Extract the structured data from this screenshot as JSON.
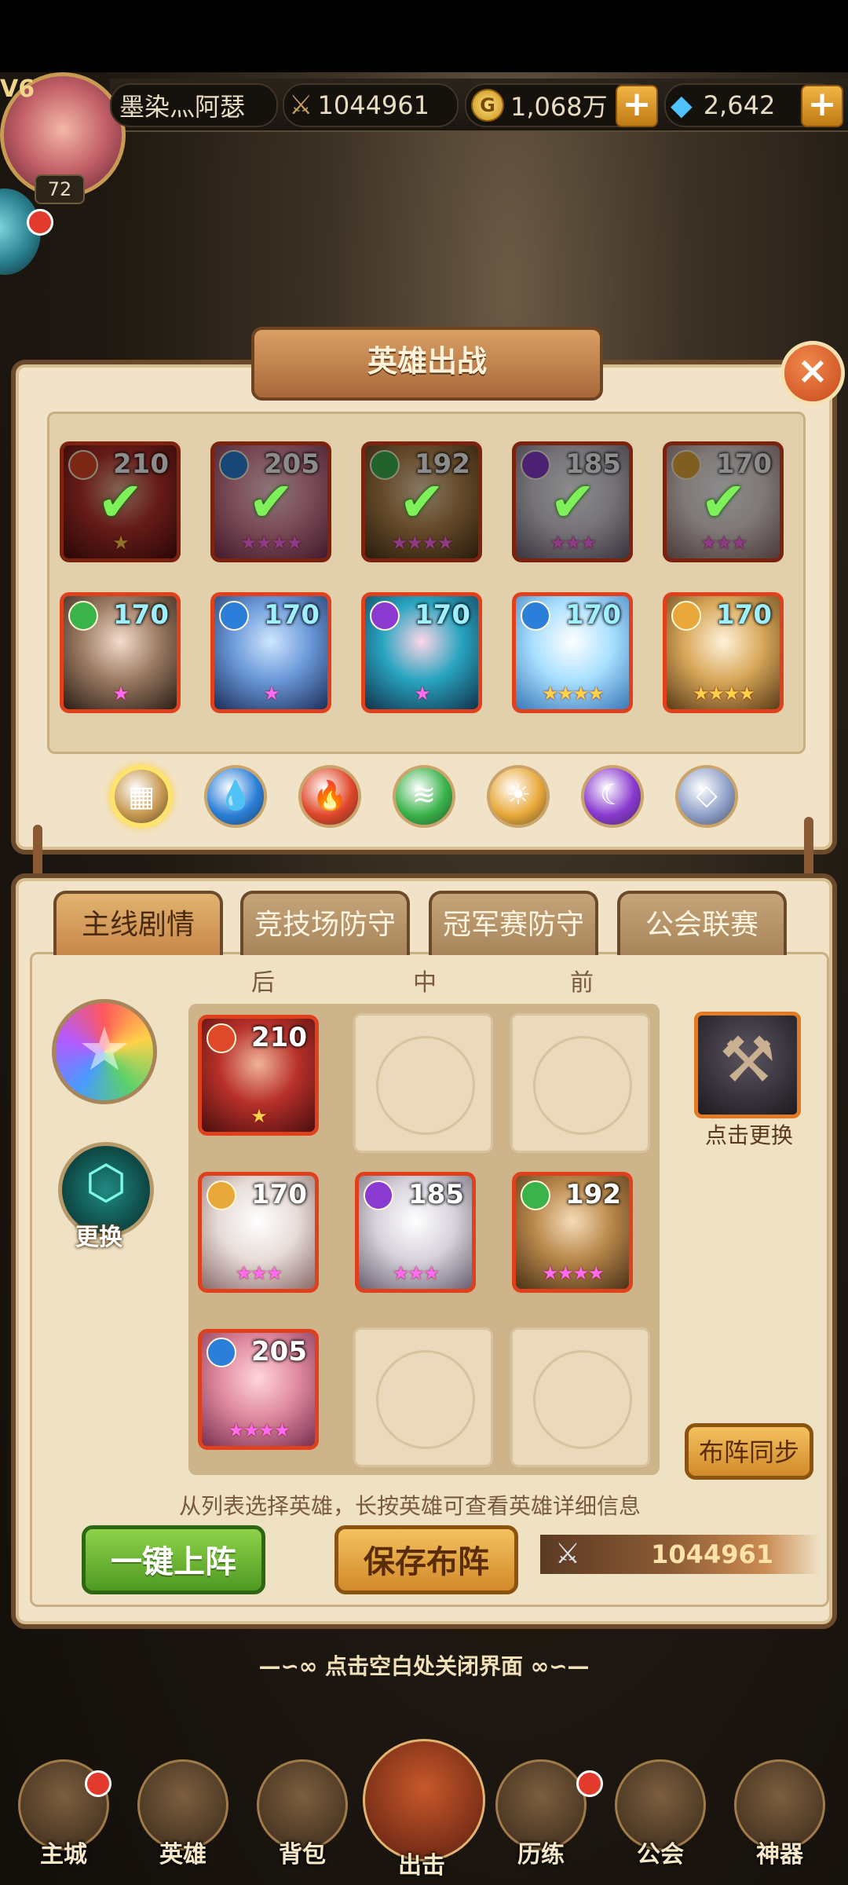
{
  "hud": {
    "vip": "V6",
    "level": "72",
    "player_name": "墨染灬阿瑟",
    "power": "1044961",
    "gold": "1,068万",
    "gems": "2,642",
    "plus": "+"
  },
  "panel": {
    "title": "英雄出战",
    "close": "×"
  },
  "heroes_top": [
    {
      "level": "210",
      "element": "fire",
      "selected": true,
      "stars": "★",
      "star_color": "gold"
    },
    {
      "level": "205",
      "element": "water",
      "selected": true,
      "stars": "★★★★",
      "star_color": "pink"
    },
    {
      "level": "192",
      "element": "wind",
      "selected": true,
      "stars": "★★★★",
      "star_color": "pink"
    },
    {
      "level": "185",
      "element": "dark",
      "selected": true,
      "stars": "★★★",
      "star_color": "pink"
    },
    {
      "level": "170",
      "element": "light",
      "selected": true,
      "stars": "★★★",
      "star_color": "pink"
    }
  ],
  "heroes_bottom": [
    {
      "level": "170",
      "element": "wind",
      "stars": "★",
      "star_color": "pink"
    },
    {
      "level": "170",
      "element": "water",
      "stars": "★",
      "star_color": "pink"
    },
    {
      "level": "170",
      "element": "dark",
      "stars": "★",
      "star_color": "pink"
    },
    {
      "level": "170",
      "element": "water",
      "stars": "★★★★",
      "star_color": "gold"
    },
    {
      "level": "170",
      "element": "light",
      "stars": "★★★★",
      "star_color": "gold"
    }
  ],
  "filters": [
    "all",
    "water",
    "fire",
    "wind",
    "light",
    "dark",
    "void"
  ],
  "tabs": [
    "主线剧情",
    "竞技场防守",
    "冠军赛防守",
    "公会联赛"
  ],
  "columns": [
    "后",
    "中",
    "前"
  ],
  "formation": {
    "swap_label": "更换",
    "artifact_label": "点击更换",
    "sync_label": "布阵同步",
    "grid": [
      {
        "level": "210",
        "element": "fire",
        "stars": "★",
        "star_color": "gold"
      },
      null,
      null,
      {
        "level": "170",
        "element": "light",
        "stars": "★★★",
        "star_color": "pink"
      },
      {
        "level": "185",
        "element": "dark",
        "stars": "★★★",
        "star_color": "pink"
      },
      {
        "level": "192",
        "element": "wind",
        "stars": "★★★★",
        "star_color": "pink"
      },
      {
        "level": "205",
        "element": "water",
        "stars": "★★★★",
        "star_color": "pink"
      },
      null,
      null
    ]
  },
  "instructions": "从列表选择英雄，长按英雄可查看英雄详细信息",
  "actions": {
    "auto_deploy": "一键上阵",
    "save": "保存布阵",
    "team_power": "1044961"
  },
  "close_hint": "点击空白处关闭界面",
  "close_hint_ornament_left": "—∽∞",
  "close_hint_ornament_right": "∞∽—",
  "nav": [
    "主城",
    "英雄",
    "背包",
    "出击",
    "历练",
    "公会",
    "神器"
  ],
  "colors": {
    "fire": "#e0482a",
    "water": "#2b7fd8",
    "wind": "#3ab34a",
    "light": "#e8a93a",
    "dark": "#8a3ad0",
    "void": "#8fa0c8",
    "all": "#c89a52"
  }
}
